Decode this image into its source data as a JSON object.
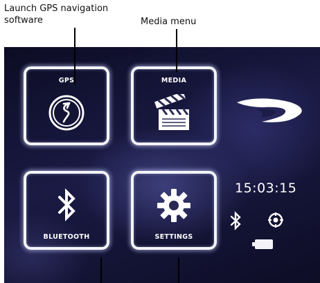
{
  "annotations": {
    "gps_callout": "Launch GPS navigation software",
    "media_callout": "Media menu"
  },
  "menu": {
    "gps_label": "GPS",
    "media_label": "MEDIA",
    "bluetooth_label": "BLUETOOTH",
    "settings_label": "SETTINGS"
  },
  "status": {
    "time": "15:03:15"
  },
  "icons": {
    "gps": "gps-navigation-icon",
    "media": "clapperboard-icon",
    "bluetooth": "bluetooth-icon",
    "settings": "gear-icon",
    "brand": "brand-logo-icon",
    "bt_status": "bluetooth-status-icon",
    "gps_status": "gps-status-icon",
    "battery": "battery-icon"
  },
  "colors": {
    "background": "#14143a",
    "tile_border": "#f4f4f8",
    "text": "#ffffff"
  }
}
